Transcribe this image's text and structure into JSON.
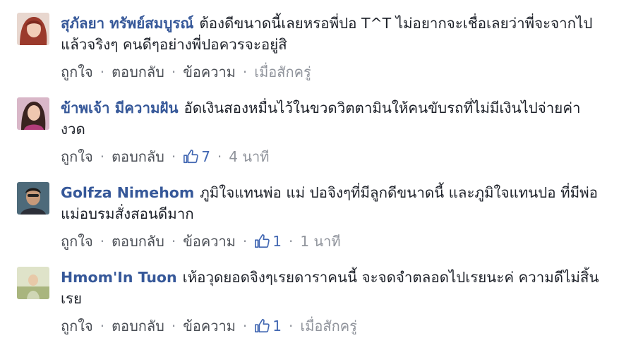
{
  "comments": [
    {
      "author": "สุภัลยา ทรัพย์สมบูรณ์",
      "text": "ต้องดีขนาดนี้เลยหรอพี่ปอ T^T ไม่อยากจะเชื่อเลยว่าพี่จะจากไปแล้วจริงๆ คนดีๆอย่างพี่ปอควรจะอยู่สิ",
      "like_label": "ถูกใจ",
      "reply_label": "ตอบกลับ",
      "message_label": "ข้อความ",
      "time": "เมื่อสักครู่"
    },
    {
      "author": "ข้าพเจ้า มีความฝัน",
      "text": "อัดเงินสองหมื่นไว้ในขวดวิตตามินให้คนขับรถที่ไม่มีเงินไปจ่ายค่างวด",
      "like_label": "ถูกใจ",
      "reply_label": "ตอบกลับ",
      "likes": "7",
      "time": "4 นาที"
    },
    {
      "author": "Golfza Nimehom",
      "text": "ภูมิใจแทนพ่อ แม่ ปอจิงๆที่มีลูกดีขนาดนี้ และภูมิใจแทนปอ ที่มีพ่อแม่อบรมสั่งสอนดีมาก",
      "like_label": "ถูกใจ",
      "reply_label": "ตอบกลับ",
      "message_label": "ข้อความ",
      "likes": "1",
      "time": "1 นาที"
    },
    {
      "author": "Hmom'In Tuon",
      "text": "เห้อวุดยอดจิงๆเรยดาราคนนี้ จะจดจำตลอดไปเรยนะค่ ความดีไม่สิ้นเรย",
      "like_label": "ถูกใจ",
      "reply_label": "ตอบกลับ",
      "message_label": "ข้อความ",
      "likes": "1",
      "time": "เมื่อสักครู่"
    }
  ],
  "colors": {
    "author": "#365899",
    "action_text": "#4b4f56",
    "meta": "#90949c",
    "like_icon": "#4267b2"
  }
}
